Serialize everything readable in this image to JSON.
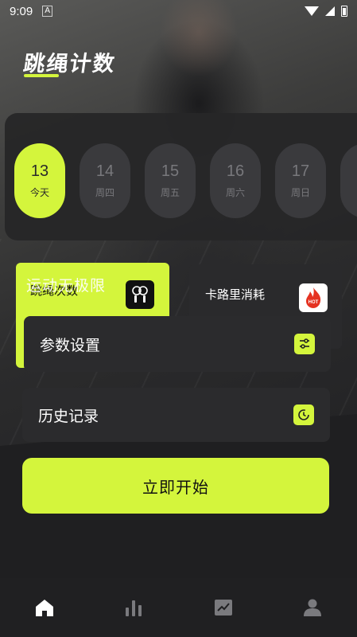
{
  "status_bar": {
    "time": "9:09",
    "notif": "A"
  },
  "header": {
    "title": "跳绳计数"
  },
  "dates": [
    {
      "day": "13",
      "weekday": "今天",
      "active": true
    },
    {
      "day": "14",
      "weekday": "周四",
      "active": false
    },
    {
      "day": "15",
      "weekday": "周五",
      "active": false
    },
    {
      "day": "16",
      "weekday": "周六",
      "active": false
    },
    {
      "day": "17",
      "weekday": "周日",
      "active": false
    }
  ],
  "overlay_text": "运动无极限",
  "cards": {
    "count_label": "跳绳次数",
    "calories_label": "卡路里消耗",
    "hot_badge": "HOT",
    "params_label": "参数设置",
    "history_label": "历史记录"
  },
  "start_button": "立即开始",
  "nav": [
    "home-icon",
    "stats-icon",
    "trend-icon",
    "profile-icon"
  ],
  "colors": {
    "accent": "#d4f53c",
    "card": "#2b2b2d",
    "background": "#1f1f21"
  }
}
